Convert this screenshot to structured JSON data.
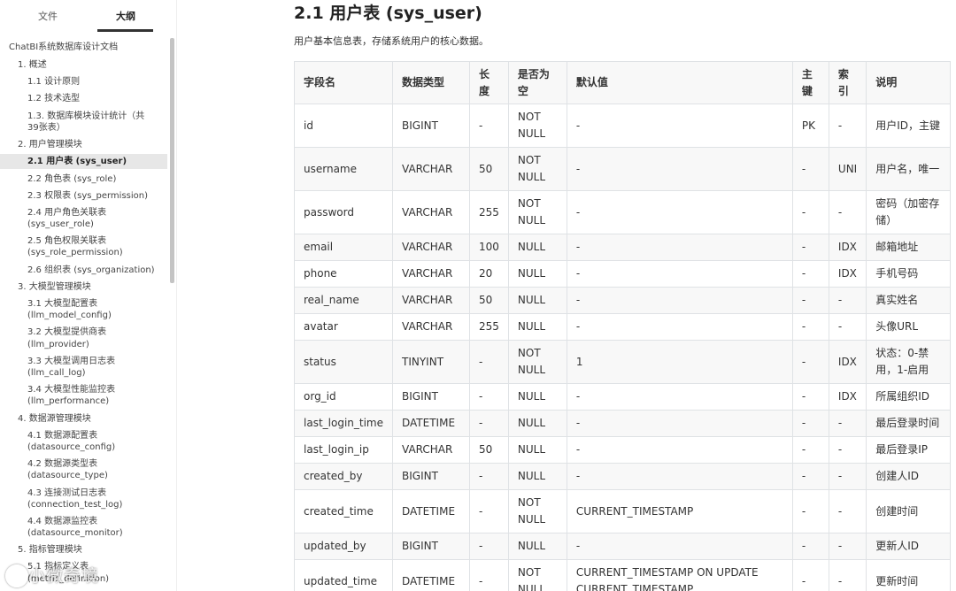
{
  "sidebar": {
    "tabs": [
      "文件",
      "大纲"
    ],
    "toc": [
      {
        "label": "ChatBI系统数据库设计文档"
      },
      {
        "label": "1. 概述"
      },
      {
        "label": "1.1 设计原则"
      },
      {
        "label": "1.2 技术选型"
      },
      {
        "label": "1.3. 数据库模块设计统计（共"
      },
      {
        "label": "39张表）"
      },
      {
        "label": "2. 用户管理模块"
      },
      {
        "label": "2.1 用户表 (sys_user)"
      },
      {
        "label": "2.2 角色表 (sys_role)"
      },
      {
        "label": "2.3 权限表 (sys_permission)"
      },
      {
        "label": "2.4 用户角色关联表"
      },
      {
        "label": "(sys_user_role)"
      },
      {
        "label": "2.5 角色权限关联表"
      },
      {
        "label": "(sys_role_permission)"
      },
      {
        "label": "2.6 组织表 (sys_organization)"
      },
      {
        "label": "3. 大模型管理模块"
      },
      {
        "label": "3.1 大模型配置表"
      },
      {
        "label": "(llm_model_config)"
      },
      {
        "label": "3.2 大模型提供商表"
      },
      {
        "label": "(llm_provider)"
      },
      {
        "label": "3.3 大模型调用日志表"
      },
      {
        "label": "(llm_call_log)"
      },
      {
        "label": "3.4 大模型性能监控表"
      },
      {
        "label": "(llm_performance)"
      },
      {
        "label": "4. 数据源管理模块"
      },
      {
        "label": "4.1 数据源配置表"
      },
      {
        "label": "(datasource_config)"
      },
      {
        "label": "4.2 数据源类型表"
      },
      {
        "label": "(datasource_type)"
      },
      {
        "label": "4.3 连接测试日志表"
      },
      {
        "label": "(connection_test_log)"
      },
      {
        "label": "4.4 数据源监控表"
      },
      {
        "label": "(datasource_monitor)"
      },
      {
        "label": "5. 指标管理模块"
      },
      {
        "label": "5.1 指标定义表"
      },
      {
        "label": "(metric_definition)"
      }
    ],
    "watermark": "小微奇境"
  },
  "main": {
    "title": "2.1 用户表 (sys_user)",
    "description": "用户基本信息表，存储系统用户的核心数据。",
    "table": {
      "headers": [
        "字段名",
        "数据类型",
        "长度",
        "是否为空",
        "默认值",
        "主键",
        "索引",
        "说明"
      ],
      "rows": [
        [
          "id",
          "BIGINT",
          "-",
          "NOT NULL",
          "-",
          "PK",
          "-",
          "用户ID，主键"
        ],
        [
          "username",
          "VARCHAR",
          "50",
          "NOT NULL",
          "-",
          "-",
          "UNI",
          "用户名，唯一"
        ],
        [
          "password",
          "VARCHAR",
          "255",
          "NOT NULL",
          "-",
          "-",
          "-",
          "密码（加密存储）"
        ],
        [
          "email",
          "VARCHAR",
          "100",
          "NULL",
          "-",
          "-",
          "IDX",
          "邮箱地址"
        ],
        [
          "phone",
          "VARCHAR",
          "20",
          "NULL",
          "-",
          "-",
          "IDX",
          "手机号码"
        ],
        [
          "real_name",
          "VARCHAR",
          "50",
          "NULL",
          "-",
          "-",
          "-",
          "真实姓名"
        ],
        [
          "avatar",
          "VARCHAR",
          "255",
          "NULL",
          "-",
          "-",
          "-",
          "头像URL"
        ],
        [
          "status",
          "TINYINT",
          "-",
          "NOT NULL",
          "1",
          "-",
          "IDX",
          "状态：0-禁用，1-启用"
        ],
        [
          "org_id",
          "BIGINT",
          "-",
          "NULL",
          "-",
          "-",
          "IDX",
          "所属组织ID"
        ],
        [
          "last_login_time",
          "DATETIME",
          "-",
          "NULL",
          "-",
          "-",
          "-",
          "最后登录时间"
        ],
        [
          "last_login_ip",
          "VARCHAR",
          "50",
          "NULL",
          "-",
          "-",
          "-",
          "最后登录IP"
        ],
        [
          "created_by",
          "BIGINT",
          "-",
          "NULL",
          "-",
          "-",
          "-",
          "创建人ID"
        ],
        [
          "created_time",
          "DATETIME",
          "-",
          "NOT NULL",
          "CURRENT_TIMESTAMP",
          "-",
          "-",
          "创建时间"
        ],
        [
          "updated_by",
          "BIGINT",
          "-",
          "NULL",
          "-",
          "-",
          "-",
          "更新人ID"
        ],
        [
          "updated_time",
          "DATETIME",
          "-",
          "NOT NULL",
          "CURRENT_TIMESTAMP ON UPDATE CURRENT_TIMESTAMP",
          "-",
          "-",
          "更新时间"
        ]
      ]
    }
  }
}
